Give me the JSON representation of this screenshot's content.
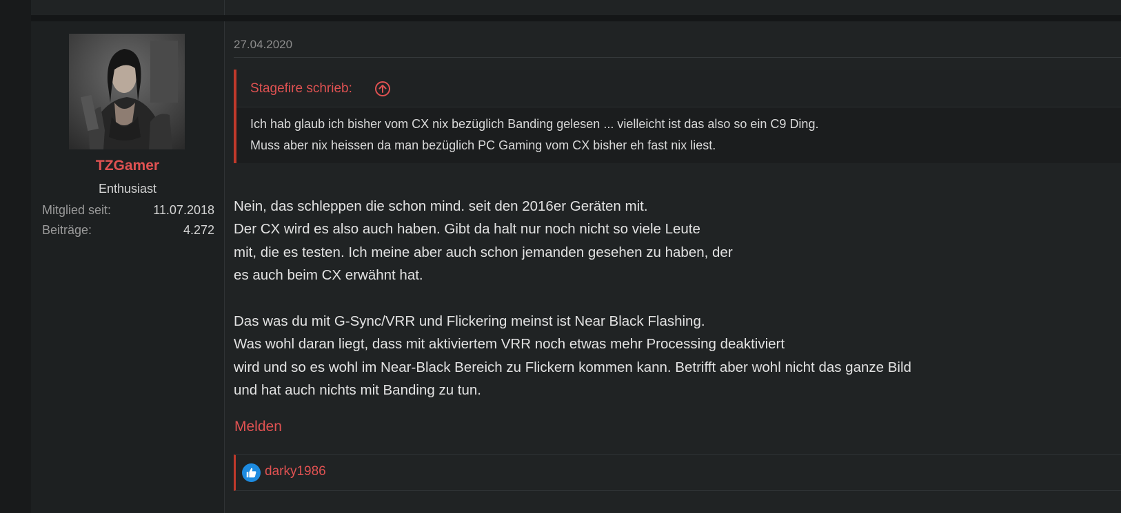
{
  "post": {
    "date": "27.04.2020",
    "author": {
      "name": "TZGamer",
      "title": "Enthusiast",
      "avatar_icon": "user-avatar",
      "stats": [
        {
          "label": "Mitglied seit:",
          "value": "11.07.2018"
        },
        {
          "label": "Beiträge:",
          "value": "4.272"
        }
      ]
    },
    "quote": {
      "author_label": "Stagefire schrieb:",
      "jump_icon": "arrow-up-circle-icon",
      "lines": [
        "Ich hab glaub ich bisher vom CX nix bezüglich Banding gelesen ... vielleicht ist das also so ein C9 Ding.",
        "Muss aber nix heissen da man bezüglich PC Gaming vom CX bisher eh fast nix liest."
      ]
    },
    "body_lines": [
      "Nein, das schleppen die schon mind. seit den 2016er Geräten mit.",
      "Der CX wird es also auch haben. Gibt da halt nur noch nicht so viele Leute",
      "mit, die es testen. Ich meine aber auch schon jemanden gesehen zu haben, der",
      "es auch beim CX erwähnt hat.",
      "",
      "Das was du mit G-Sync/VRR und Flickering meinst ist Near Black Flashing.",
      "Was wohl daran liegt, dass mit aktiviertem VRR noch etwas mehr Processing deaktiviert",
      "wird und so es wohl im Near-Black Bereich zu Flickern kommen kann. Betrifft aber wohl nicht das ganze Bild",
      "und hat auch nichts mit Banding zu tun."
    ],
    "report_label": "Melden",
    "reactions": {
      "icon": "thumbs-up-icon",
      "users": [
        "darky1986"
      ]
    }
  },
  "colors": {
    "accent": "#e05252",
    "quote_bar": "#c0392b",
    "like_blue": "#1d8be0",
    "background": "#202324"
  }
}
